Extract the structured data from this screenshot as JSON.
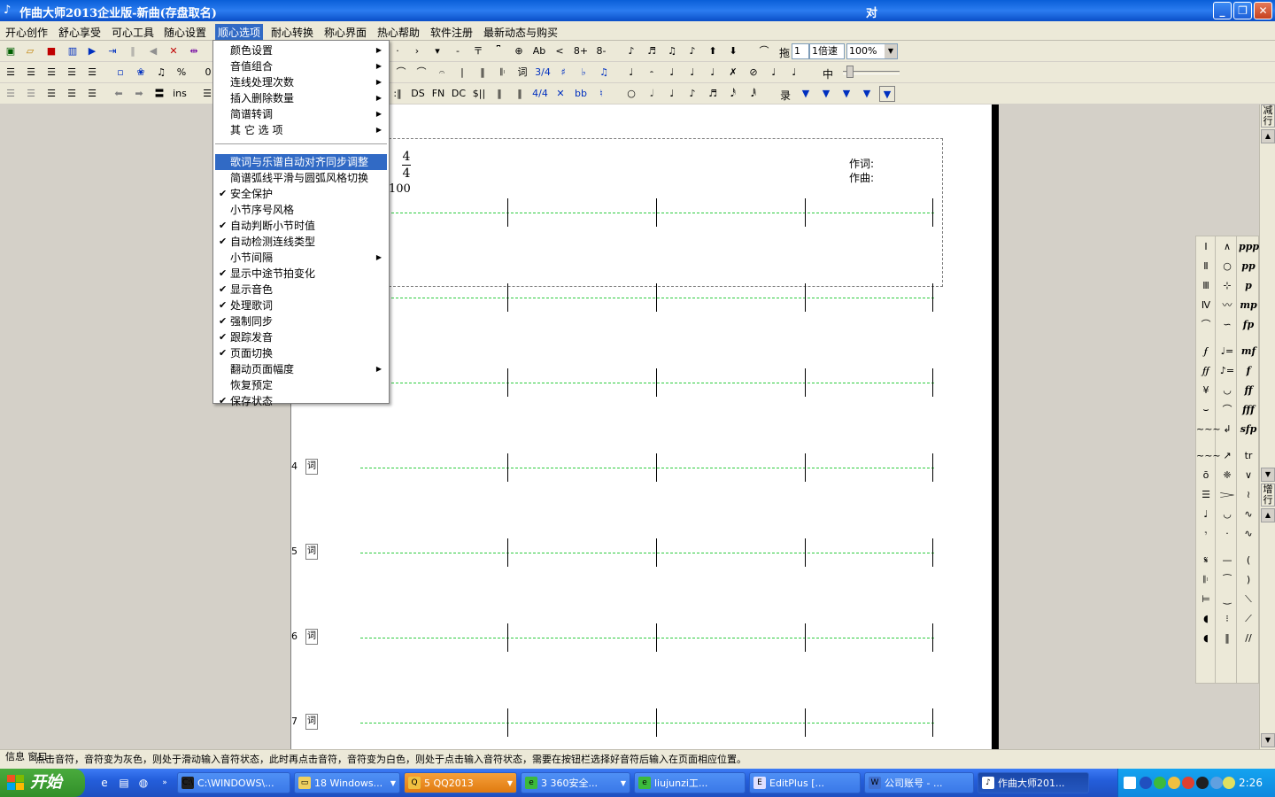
{
  "window": {
    "title": "作曲大师2013企业版-新曲(存盘取名)",
    "title_mid": "对"
  },
  "menu": [
    "开心创作",
    "舒心享受",
    "可心工具",
    "随心设置",
    "顺心选项",
    "耐心转换",
    "称心界面",
    "热心帮助",
    "软件注册",
    "最新动态与购买"
  ],
  "toolbar": {
    "speed_value": "1",
    "speed_label": "拖",
    "rate_value": "1倍速",
    "zoom_value": "100%",
    "mid_label": "中",
    "record_label": "录",
    "insert_label": "ins",
    "row2_zero": "0",
    "row1_text": [
      "Ab",
      "8+",
      "8-"
    ],
    "row3_text": [
      "DS",
      "FN",
      "DC",
      "$||",
      "4/4",
      "bb"
    ],
    "word_label": "词",
    "sig_label": "3/4"
  },
  "dropdown": [
    {
      "label": "颜色设置",
      "checked": false,
      "submenu": true
    },
    {
      "label": "音值组合",
      "checked": false,
      "submenu": true
    },
    {
      "label": "连线处理次数",
      "checked": false,
      "submenu": true
    },
    {
      "label": "插入删除数量",
      "checked": false,
      "submenu": true
    },
    {
      "label": "简谱转调",
      "checked": false,
      "submenu": true
    },
    {
      "label": "其 它 选 项",
      "checked": false,
      "submenu": true
    },
    {
      "sep": true
    },
    {
      "label": "歌词与乐谱自动对齐同步调整",
      "checked": false,
      "submenu": false,
      "highlight": true
    },
    {
      "label": "简谱弧线平滑与圆弧风格切换",
      "checked": false,
      "submenu": false
    },
    {
      "label": "安全保护",
      "checked": true,
      "submenu": false
    },
    {
      "label": "小节序号风格",
      "checked": false,
      "submenu": false
    },
    {
      "label": "自动判断小节时值",
      "checked": true,
      "submenu": false
    },
    {
      "label": "自动检测连线类型",
      "checked": true,
      "submenu": false
    },
    {
      "label": "小节间隔",
      "checked": false,
      "submenu": true
    },
    {
      "label": "显示中途节拍变化",
      "checked": true,
      "submenu": false
    },
    {
      "label": "显示音色",
      "checked": true,
      "submenu": false
    },
    {
      "label": "处理歌词",
      "checked": true,
      "submenu": false
    },
    {
      "label": "强制同步",
      "checked": true,
      "submenu": false
    },
    {
      "label": "跟踪发音",
      "checked": true,
      "submenu": false
    },
    {
      "label": "页面切换",
      "checked": true,
      "submenu": false
    },
    {
      "label": "翻动页面幅度",
      "checked": false,
      "submenu": true
    },
    {
      "label": "恢复预定",
      "checked": false,
      "submenu": false
    },
    {
      "label": "保存状态",
      "checked": true,
      "submenu": false
    }
  ],
  "score": {
    "time_sig_top": "4",
    "time_sig_bottom": "4",
    "tempo": "100",
    "lyricist_label": "作词:",
    "composer_label": "作曲:",
    "rows": [
      {
        "num": "",
        "tag": ""
      },
      {
        "num": "",
        "tag": ""
      },
      {
        "num": "",
        "tag": ""
      },
      {
        "num": "4",
        "tag": "词"
      },
      {
        "num": "5",
        "tag": "词"
      },
      {
        "num": "6",
        "tag": "词"
      },
      {
        "num": "7",
        "tag": "词"
      }
    ]
  },
  "scrollbar": {
    "top_label": "减行",
    "bottom_label": "增行"
  },
  "palette": {
    "col1": [
      "Ⅰ",
      "Ⅱ",
      "Ⅲ",
      "Ⅳ",
      "⌒",
      "𝆑",
      "𝆑𝆑",
      "¥",
      "⌣",
      "~~~",
      "~~~",
      "ō",
      "☰",
      "♩",
      "𝄾",
      "𝄋",
      "𝄆",
      "⊨",
      "◖",
      "◖"
    ],
    "col2": [
      "∧",
      "○",
      "⊹",
      "〰",
      "∽",
      "♩=",
      "♪=",
      "◡",
      "⌒",
      "↲",
      "↗",
      "❈",
      "𝆓",
      "◡",
      "·",
      "—",
      "⁀",
      "‿",
      "⁝",
      "‖"
    ],
    "col3": [
      "ppp",
      "pp",
      "p",
      "mp",
      "fp",
      "mf",
      "f",
      "ff",
      "fff",
      "sfp",
      "tr",
      "∨",
      "≀",
      "∿",
      "∿",
      "(",
      ")",
      "⟍",
      "⟋",
      "//"
    ],
    "dyn_col3": true
  },
  "status": {
    "label": "信息 窗口",
    "text": "点击音符，音符变为灰色，则处于滑动输入音符状态，此时再点击音符，音符变为白色，则处于点击输入音符状态，需要在按钮栏选择好音符后输入在页面相应位置。"
  },
  "taskbar": {
    "start_label": "开始",
    "buttons": [
      {
        "label": "C:\\WINDOWS\\...",
        "icon": "C:\\",
        "active": false,
        "caret": false
      },
      {
        "label": "18 Windows...",
        "icon": "▭",
        "active": false,
        "caret": true
      },
      {
        "label": "5 QQ2013",
        "icon": "Q",
        "active": false,
        "caret": true,
        "orange": true
      },
      {
        "label": "3 360安全...",
        "icon": "e",
        "active": false,
        "caret": true
      },
      {
        "label": "liujunzi工...",
        "icon": "e",
        "active": false,
        "caret": false
      },
      {
        "label": "EditPlus [...",
        "icon": "E",
        "active": false,
        "caret": false
      },
      {
        "label": "公司账号 - ...",
        "icon": "W",
        "active": false,
        "caret": false
      },
      {
        "label": "作曲大师201...",
        "icon": "♪",
        "active": true,
        "caret": false
      }
    ],
    "clock": "2:26"
  },
  "colors": {
    "accent": "#316ac5",
    "staff_line": "#2ecc40",
    "taskbar": "#245edb",
    "start": "#318f29"
  }
}
